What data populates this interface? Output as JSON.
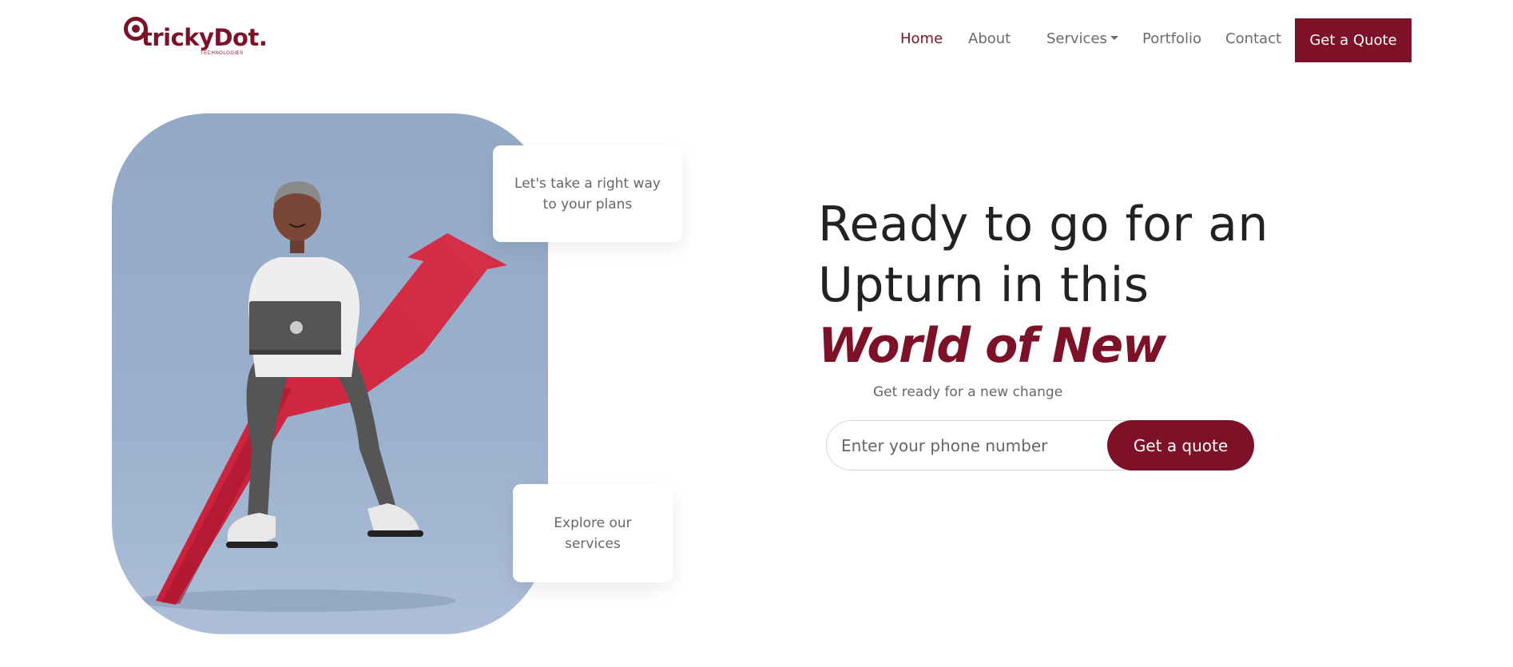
{
  "brand": {
    "name": "trickyDot.",
    "tagline": "TECHNOLOGIES",
    "accent_color": "#7d1128"
  },
  "nav": {
    "items": [
      {
        "label": "Home",
        "active": true
      },
      {
        "label": "About",
        "active": false
      },
      {
        "label": "Services",
        "active": false,
        "has_dropdown": true
      },
      {
        "label": "Portfolio",
        "active": false
      },
      {
        "label": "Contact",
        "active": false
      }
    ],
    "cta_label": "Get a Quote"
  },
  "hero": {
    "image_icon": "person-on-arrow-illustration",
    "card_top": "Let's take a right way to your plans",
    "card_bottom": "Explore our services",
    "headline_line1": "Ready to go for an",
    "headline_line2": "Upturn in this",
    "headline_accent": "World of New",
    "subtitle": "Get ready for a new change",
    "phone_placeholder": "Enter your phone number",
    "phone_button": "Get a quote"
  }
}
